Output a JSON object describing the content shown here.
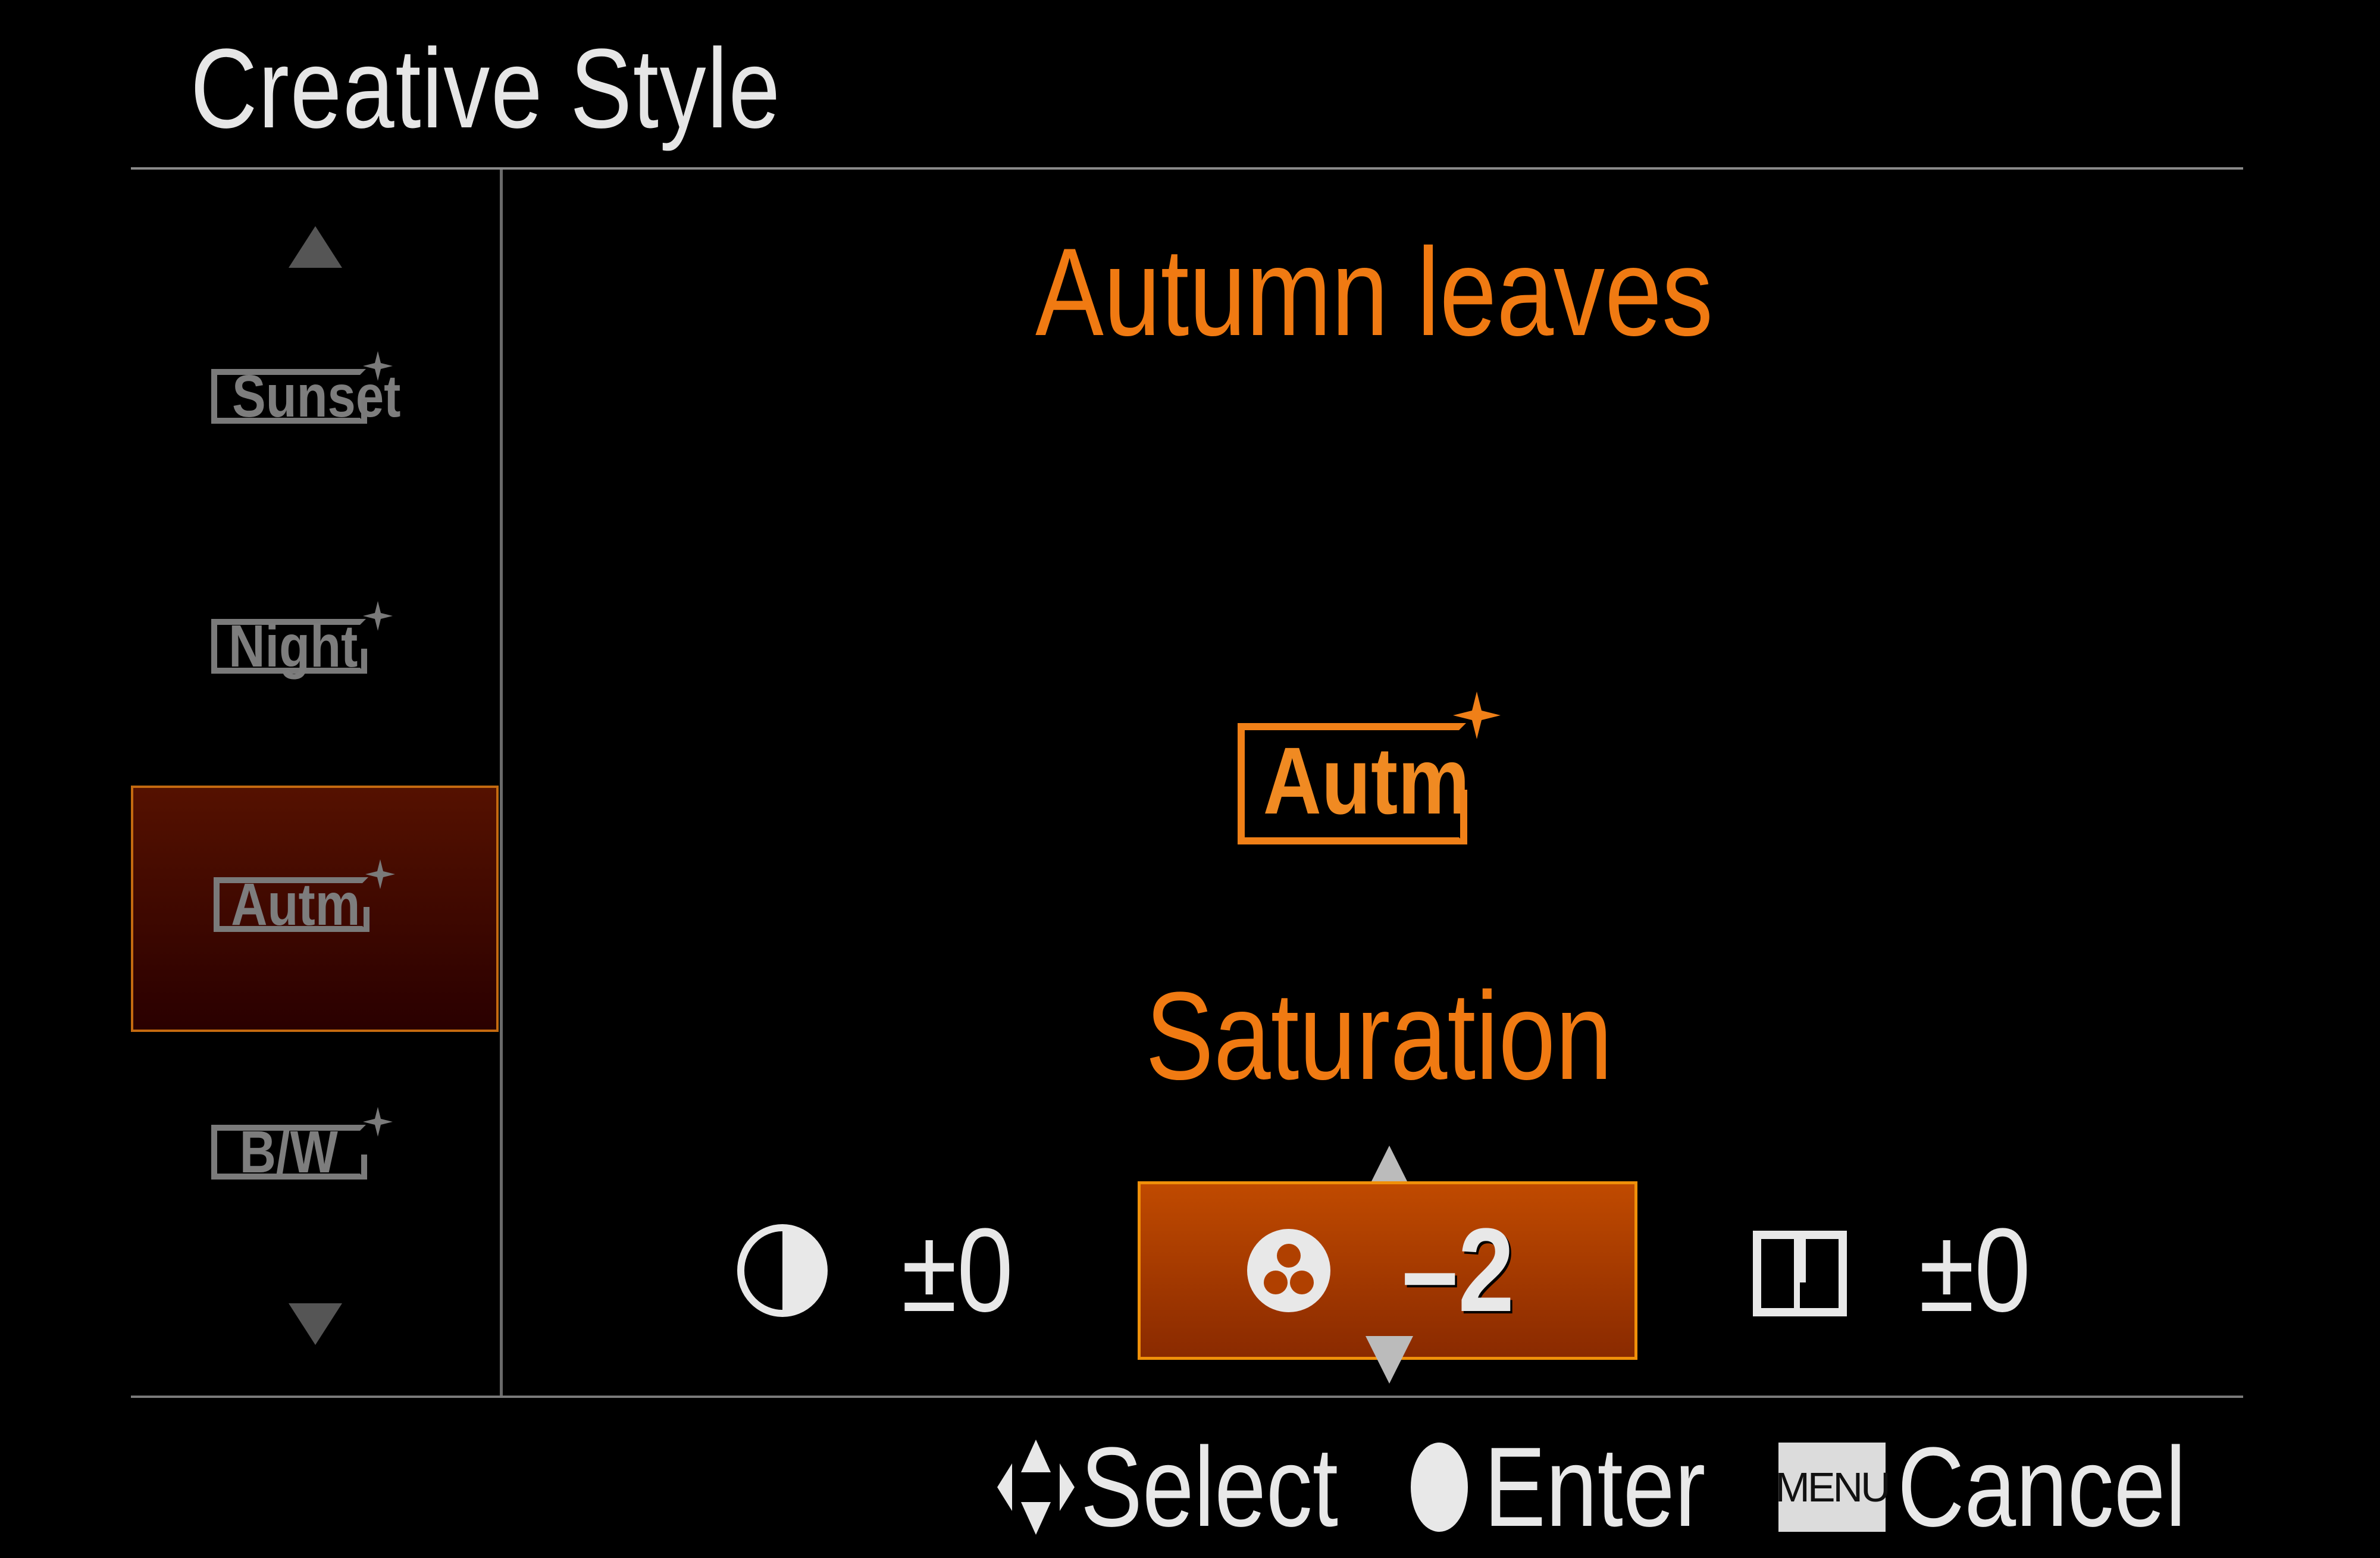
{
  "header": {
    "title": "Creative Style"
  },
  "sidebar": {
    "scroll_up_icon": "triangle-up",
    "scroll_down_icon": "triangle-down",
    "items": [
      {
        "label": "Sunset",
        "selected": false
      },
      {
        "label": "Night",
        "selected": false
      },
      {
        "label": "Autm",
        "selected": true
      },
      {
        "label": "B/W",
        "selected": false
      }
    ]
  },
  "main": {
    "style_name": "Autumn leaves",
    "style_badge": "Autm",
    "parameter_title": "Saturation",
    "parameters": [
      {
        "name": "contrast",
        "icon": "contrast-icon",
        "value": "±0",
        "selected": false
      },
      {
        "name": "saturation",
        "icon": "saturation-icon",
        "value": "–2",
        "selected": true
      },
      {
        "name": "sharpness",
        "icon": "sharpness-icon",
        "value": "±0",
        "selected": false
      }
    ]
  },
  "footer": {
    "select_label": "Select",
    "enter_label": "Enter",
    "menu_key": "MENU",
    "cancel_label": "Cancel"
  },
  "colors": {
    "accent": "#f07a12",
    "selected_bg": "#551100",
    "inactive": "#7a7a7a"
  }
}
